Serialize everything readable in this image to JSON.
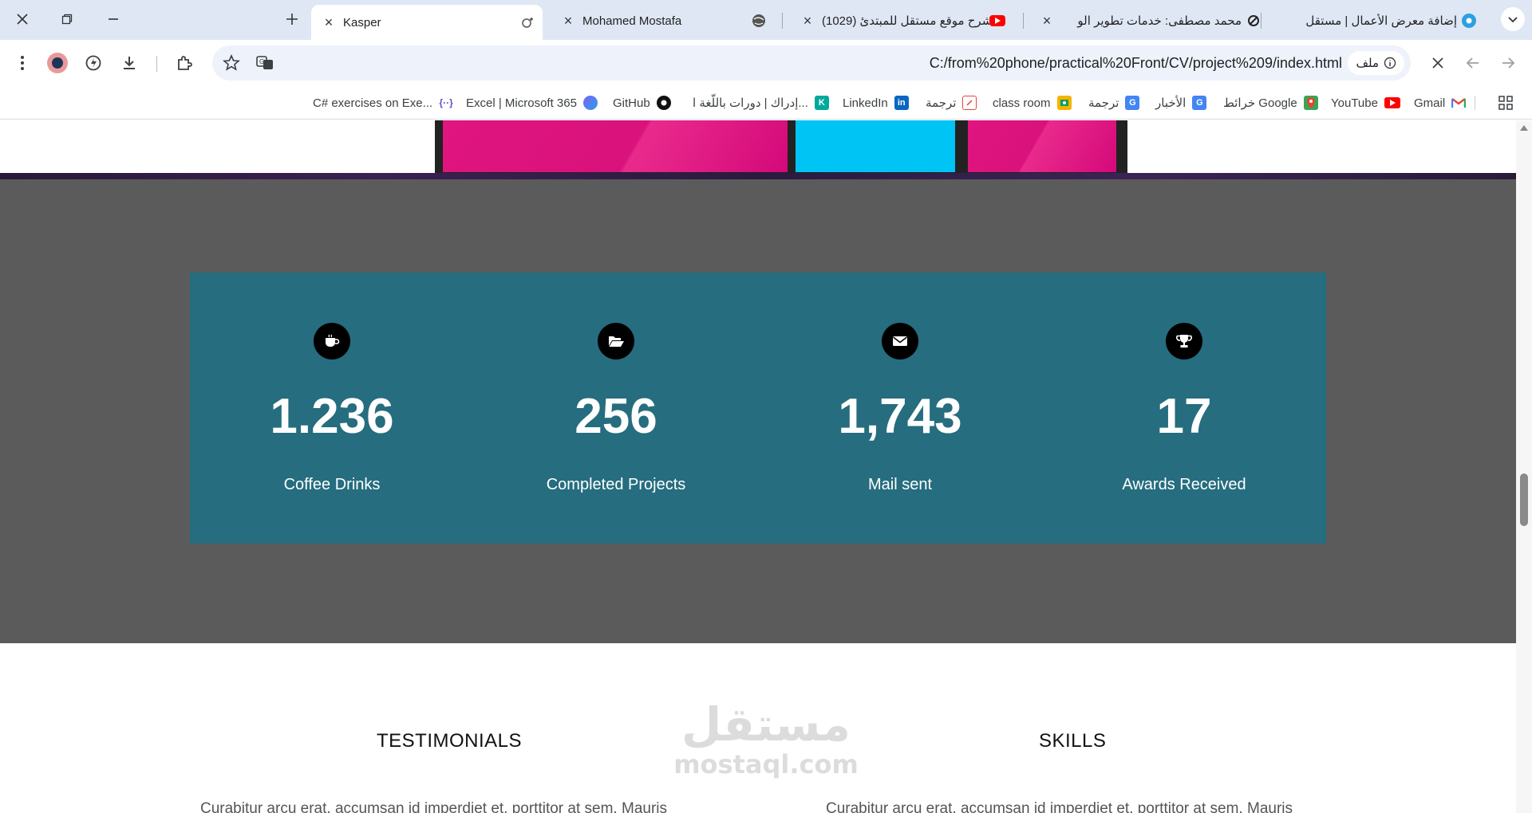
{
  "browser": {
    "tabs": [
      {
        "title": "إضافة معرض الأعمال | مستقل",
        "icon": "mostaql-icon"
      },
      {
        "title": "محمد مصطفى: خدمات تطوير الو",
        "icon": "freelancer-icon"
      },
      {
        "title": "(1029) شرح موقع مستقل للمبتدئ",
        "icon": "youtube-icon"
      },
      {
        "title": "Mohamed Mostafa",
        "icon": "globe-icon"
      },
      {
        "title": "Kasper",
        "icon": "site-icon",
        "active": true
      }
    ],
    "url": "C:/from%20phone/practical%20Front/CV/project%209/index.html",
    "site_chip_label": "ملف",
    "bookmarks": [
      {
        "label": "Gmail",
        "icon": "gmail-icon"
      },
      {
        "label": "YouTube",
        "icon": "youtube-icon"
      },
      {
        "label": "خرائط Google",
        "icon": "maps-icon"
      },
      {
        "label": "الأخبار",
        "icon": "news-icon"
      },
      {
        "label": "ترجمة",
        "icon": "translate-icon"
      },
      {
        "label": "class room",
        "icon": "classroom-icon"
      },
      {
        "label": "ترجمة",
        "icon": "translate-doc-icon"
      },
      {
        "label": "LinkedIn",
        "icon": "linkedin-icon"
      },
      {
        "label": "إدراك | دورات باللّغة ا...",
        "icon": "edraak-icon"
      },
      {
        "label": "GitHub",
        "icon": "github-icon"
      },
      {
        "label": "Excel | Microsoft 365",
        "icon": "excel-icon"
      },
      {
        "label": "C# exercises on Exe...",
        "icon": "exercism-icon"
      }
    ]
  },
  "colors": {
    "tab_strip": "#dfe7f5",
    "stats_bg": "#5b5b5b",
    "stats_box": "#256d7f",
    "magenta": "#e0157f",
    "cyan": "#00c4f4"
  },
  "stats": [
    {
      "icon": "coffee-icon",
      "value": "1.236",
      "label": "Coffee Drinks"
    },
    {
      "icon": "folder-open-icon",
      "value": "256",
      "label": "Completed Projects"
    },
    {
      "icon": "envelope-icon",
      "value": "1,743",
      "label": "Mail sent"
    },
    {
      "icon": "trophy-icon",
      "value": "17",
      "label": "Awards Received"
    }
  ],
  "sections": {
    "testimonials": {
      "title": "TESTIMONIALS",
      "text": "Curabitur arcu erat, accumsan id imperdiet et, porttitor at sem. Mauris"
    },
    "skills": {
      "title": "SKILLS",
      "text": "Curabitur arcu erat, accumsan id imperdiet et, porttitor at sem. Mauris"
    }
  },
  "watermark": {
    "arabic": "مستقل",
    "latin": "mostaql.com"
  }
}
